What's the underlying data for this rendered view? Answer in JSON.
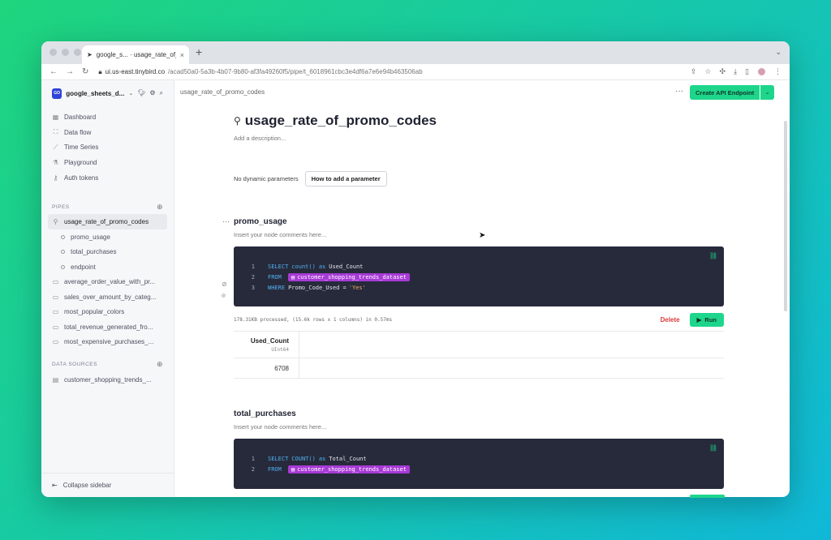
{
  "browser": {
    "tab_title": "google_s... · usage_rate_of_p",
    "tab_close": "×",
    "new_tab": "+",
    "tab_menu": "⌄",
    "url_host": "ui.us-east.tinybird.co",
    "url_path": "/acad50a0-5a3b-4b07-9b80-af3fa49260f5/pipe/t_6018961cbc3e4df6a7e6e94b463506ab"
  },
  "workspace": {
    "logo": "GO",
    "name": "google_sheets_d...",
    "caret": "⌄"
  },
  "nav": [
    {
      "label": "Dashboard",
      "icon": "dashboard-icon",
      "glyph": "▦"
    },
    {
      "label": "Data flow",
      "icon": "data-flow-icon",
      "glyph": "⛶"
    },
    {
      "label": "Time Series",
      "icon": "chart-icon",
      "glyph": "⟋"
    },
    {
      "label": "Playground",
      "icon": "playground-icon",
      "glyph": "⚗"
    },
    {
      "label": "Auth tokens",
      "icon": "key-icon",
      "glyph": "⚷"
    }
  ],
  "pipes_section": {
    "title": "PIPES",
    "plus": "⊕"
  },
  "pipes": [
    {
      "label": "usage_rate_of_promo_codes",
      "active": true
    },
    {
      "label": "average_order_value_with_pr..."
    },
    {
      "label": "sales_over_amount_by_categ..."
    },
    {
      "label": "most_popular_colors"
    },
    {
      "label": "total_revenue_generated_fro..."
    },
    {
      "label": "most_expensive_purchases_..."
    }
  ],
  "pipe_nodes": [
    "promo_usage",
    "total_purchases",
    "endpoint"
  ],
  "datasources_section": {
    "title": "DATA SOURCES",
    "plus": "⊕"
  },
  "datasources": [
    {
      "label": "customer_shopping_trends_..."
    }
  ],
  "collapse_label": "Collapse sidebar",
  "breadcrumb": "usage_rate_of_promo_codes",
  "more_menu": "···",
  "create_endpoint_label": "Create API Endpoint",
  "create_endpoint_dropdown": "⌄",
  "pipe": {
    "title": "usage_rate_of_promo_codes",
    "description_placeholder": "Add a description...",
    "params_text": "No dynamic parameters",
    "params_button": "How to add a parameter"
  },
  "node1": {
    "title": "promo_usage",
    "comment_placeholder": "Insert your node comments here...",
    "code": [
      {
        "n": "1",
        "kw": "SELECT",
        "fn": "count()",
        "kw2": "as",
        "rest": "Used_Count"
      },
      {
        "n": "2",
        "kw": "FROM",
        "ds": "customer_shopping_trends_dataset"
      },
      {
        "n": "3",
        "kw": "WHERE",
        "rest": "Promo_Code_Used =",
        "str": "'Yes'"
      }
    ],
    "stats": "178.31KB processed, (15.6k rows x 1 columns) in 0.57ms",
    "delete_label": "Delete",
    "run_label": "Run",
    "column": {
      "name": "Used_Count",
      "type": "UInt64"
    },
    "value": "6708"
  },
  "node2": {
    "title": "total_purchases",
    "comment_placeholder": "Insert your node comments here...",
    "code": [
      {
        "n": "1",
        "kw": "SELECT",
        "fn": "COUNT()",
        "kw2": "as",
        "rest": "Total_Count"
      },
      {
        "n": "2",
        "kw": "FROM",
        "ds": "customer_shopping_trends_dataset"
      }
    ]
  },
  "colors": {
    "accent": "#1ed68b",
    "editor_bg": "#272a3b",
    "datasource_chip": "#a73ad6",
    "delete": "#d93a3a"
  }
}
